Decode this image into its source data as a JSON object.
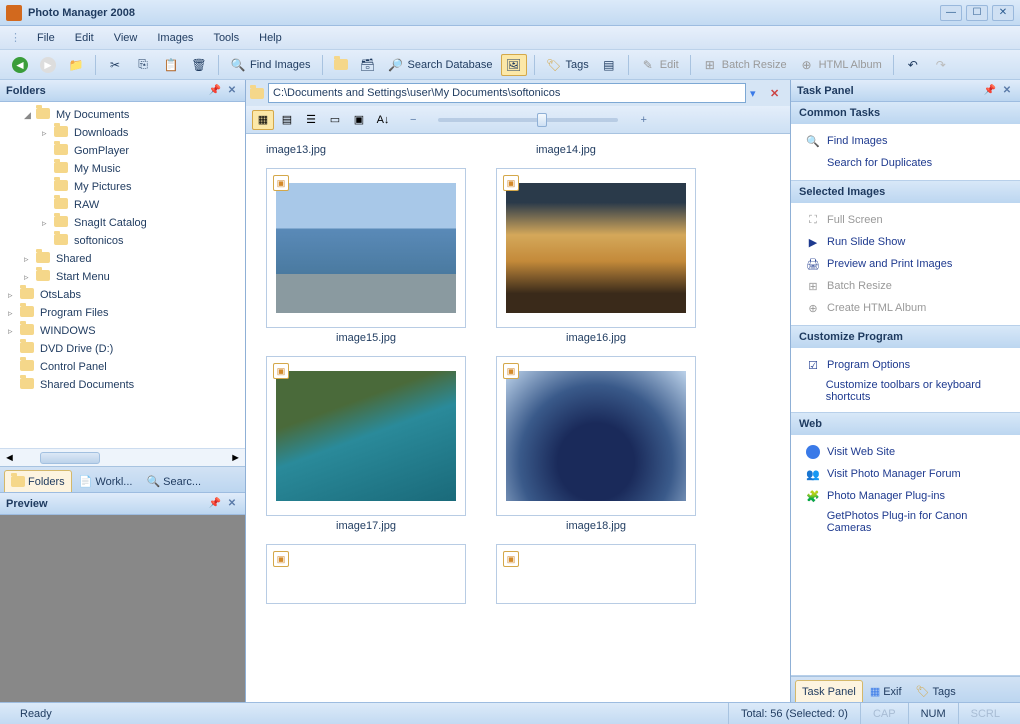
{
  "app": {
    "title": "Photo Manager 2008"
  },
  "menu": {
    "file": "File",
    "edit": "Edit",
    "view": "View",
    "images": "Images",
    "tools": "Tools",
    "help": "Help"
  },
  "toolbar": {
    "find_images": "Find Images",
    "search_database": "Search Database",
    "tags": "Tags",
    "edit": "Edit",
    "batch_resize": "Batch Resize",
    "html_album": "HTML Album"
  },
  "folders_panel": {
    "title": "Folders",
    "tree": [
      {
        "label": "My Documents",
        "level": 1,
        "expand": "◢"
      },
      {
        "label": "Downloads",
        "level": 2,
        "expand": "▹"
      },
      {
        "label": "GomPlayer",
        "level": 2,
        "expand": ""
      },
      {
        "label": "My Music",
        "level": 2,
        "expand": ""
      },
      {
        "label": "My Pictures",
        "level": 2,
        "expand": ""
      },
      {
        "label": "RAW",
        "level": 2,
        "expand": ""
      },
      {
        "label": "SnagIt Catalog",
        "level": 2,
        "expand": "▹"
      },
      {
        "label": "softonicos",
        "level": 2,
        "expand": ""
      },
      {
        "label": "Shared",
        "level": 1,
        "expand": "▹"
      },
      {
        "label": "Start Menu",
        "level": 1,
        "expand": "▹"
      },
      {
        "label": "OtsLabs",
        "level": 0,
        "expand": "▹"
      },
      {
        "label": "Program Files",
        "level": 0,
        "expand": "▹"
      },
      {
        "label": "WINDOWS",
        "level": 0,
        "expand": "▹"
      },
      {
        "label": "DVD Drive (D:)",
        "level": 0,
        "expand": ""
      },
      {
        "label": "Control Panel",
        "level": 0,
        "expand": ""
      },
      {
        "label": "Shared Documents",
        "level": 0,
        "expand": ""
      }
    ],
    "tabs": {
      "folders": "Folders",
      "worklist": "Workl...",
      "search": "Searc..."
    }
  },
  "preview_panel": {
    "title": "Preview"
  },
  "path": "C:\\Documents and Settings\\user\\My Documents\\softonicos",
  "thumbnails": [
    {
      "name": "image13.jpg"
    },
    {
      "name": "image14.jpg"
    },
    {
      "name": "image15.jpg"
    },
    {
      "name": "image16.jpg"
    },
    {
      "name": "image17.jpg"
    },
    {
      "name": "image18.jpg"
    }
  ],
  "task_panel": {
    "title": "Task Panel",
    "common_tasks": {
      "title": "Common Tasks",
      "find_images": "Find Images",
      "search_duplicates": "Search for Duplicates"
    },
    "selected_images": {
      "title": "Selected Images",
      "full_screen": "Full Screen",
      "slide_show": "Run Slide Show",
      "preview_print": "Preview and Print Images",
      "batch_resize": "Batch Resize",
      "html_album": "Create HTML Album"
    },
    "customize": {
      "title": "Customize Program",
      "options": "Program Options",
      "customize_toolbars": "Customize toolbars or keyboard shortcuts"
    },
    "web": {
      "title": "Web",
      "visit_site": "Visit Web Site",
      "forum": "Visit Photo Manager Forum",
      "plugins": "Photo Manager Plug-ins",
      "getphotos": "GetPhotos Plug-in for Canon Cameras"
    },
    "tabs": {
      "task_panel": "Task Panel",
      "exif": "Exif",
      "tags": "Tags"
    }
  },
  "statusbar": {
    "ready": "Ready",
    "total": "Total: 56 (Selected: 0)",
    "cap": "CAP",
    "num": "NUM",
    "scrl": "SCRL"
  }
}
